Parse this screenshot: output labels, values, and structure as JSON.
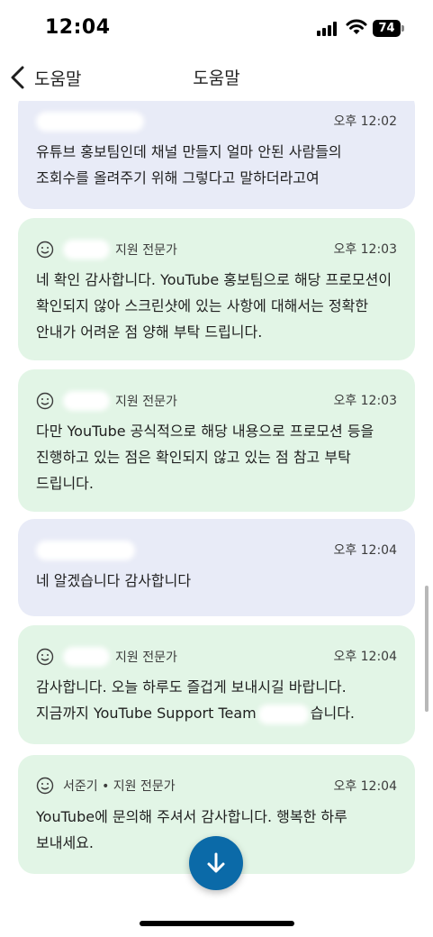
{
  "status_bar": {
    "time": "12:04",
    "battery": "74"
  },
  "nav": {
    "back_label": "도움말",
    "title": "도움말"
  },
  "messages": [
    {
      "role": "user",
      "sender": "",
      "time": "오후 12:02",
      "text": "유튜브 홍보팀인데 채널 만들지 얼마 안된 사람들의 조회수를 올려주기 위해 그렇다고 말하더라고여"
    },
    {
      "role": "agent",
      "sender": "지원 전문가",
      "time": "오후 12:03",
      "text": "네 확인 감사합니다. YouTube 홍보팀으로 해당 프로모션이 확인되지 않아 스크린샷에 있는 사항에 대해서는 정확한 안내가 어려운 점 양해 부탁 드립니다."
    },
    {
      "role": "agent",
      "sender": "지원 전문가",
      "time": "오후 12:03",
      "text": "다만 YouTube 공식적으로 해당 내용으로 프로모션 등을 진행하고 있는 점은 확인되지 않고 있는 점 참고 부탁 드립니다."
    },
    {
      "role": "user",
      "sender": "",
      "time": "오후 12:04",
      "text": "네 알겠습니다 감사합니다"
    },
    {
      "role": "agent",
      "sender": "지원 전문가",
      "time": "오후 12:04",
      "text_before": "감사합니다. 오늘 하루도 즐겁게 보내시길 바랍니다. 지금까지 YouTube Support Team",
      "text_after": "습니다."
    },
    {
      "role": "agent",
      "sender": "서준기 • 지원 전문가",
      "time": "오후 12:04",
      "text": "YouTube에 문의해 주셔서 감사합니다. 행복한 하루 보내세요."
    }
  ],
  "icons": {
    "back": "chevron-left-icon",
    "agent_avatar": "smiley-icon",
    "scroll_down": "arrow-down-icon"
  },
  "colors": {
    "user_bubble": "#e8ebf7",
    "agent_bubble": "#e2f5e6",
    "fab": "#0b6aa8"
  }
}
